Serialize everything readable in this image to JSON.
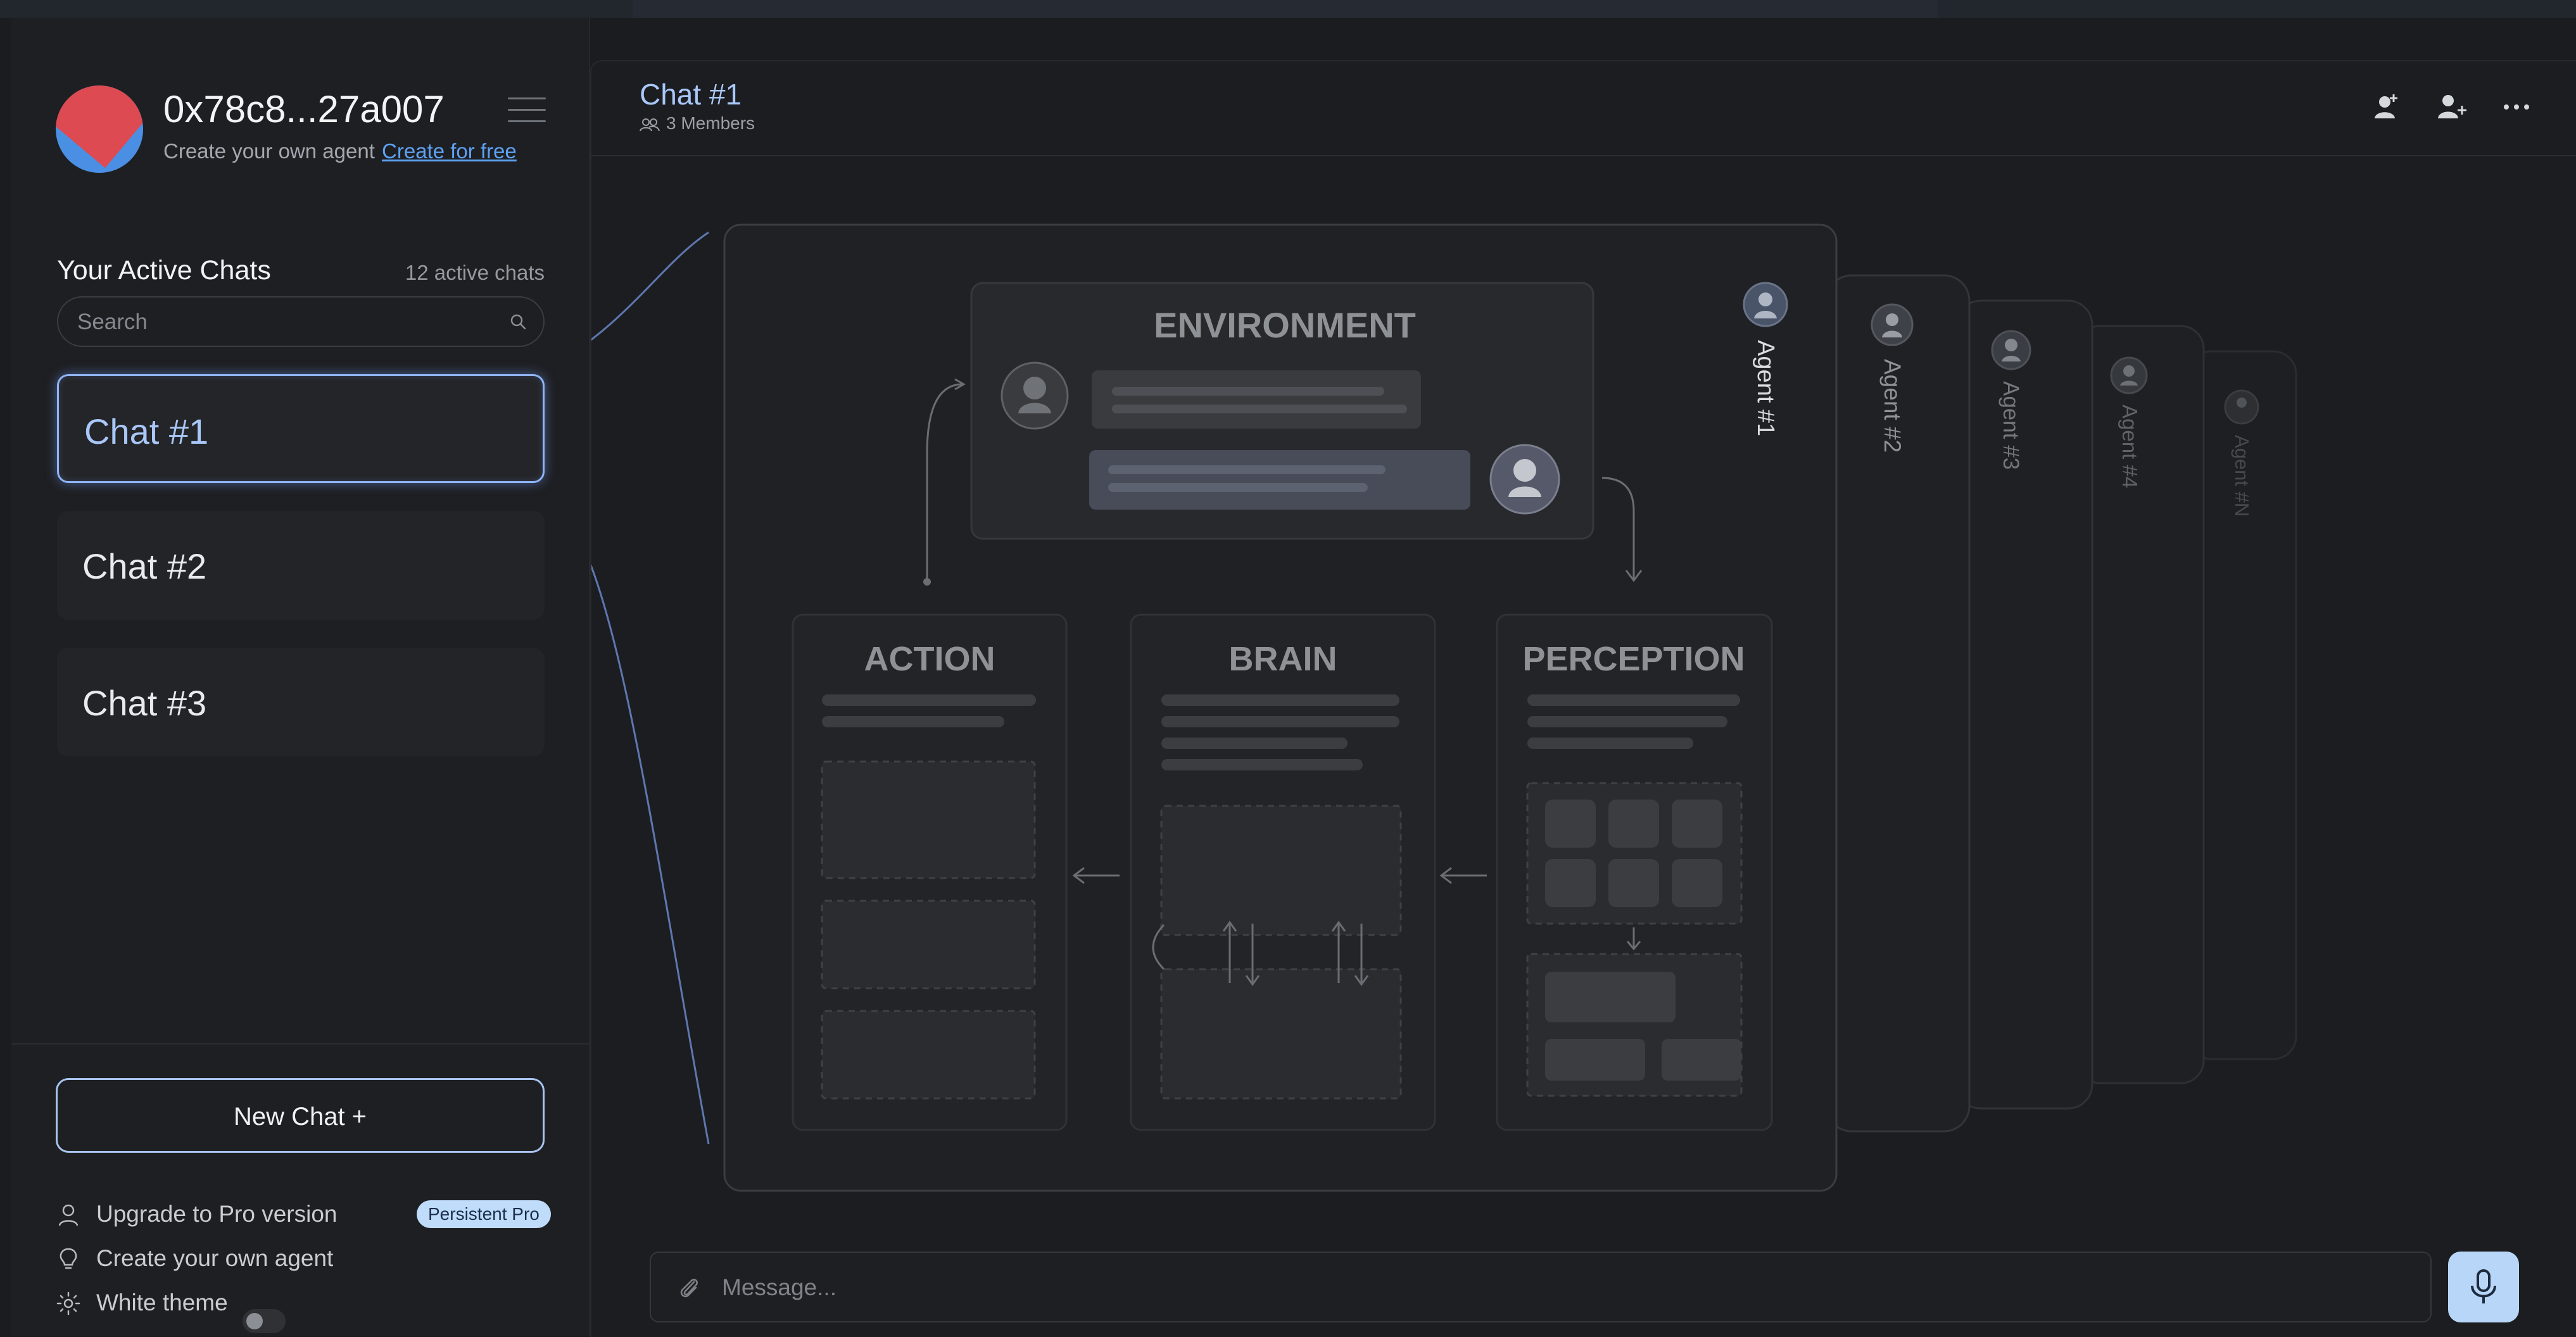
{
  "account": {
    "address": "0x78c8...27a007",
    "subtitle": "Create your own agent",
    "link_label": "Create for free"
  },
  "chats_section": {
    "title": "Your Active Chats",
    "count": "12 active chats",
    "search_placeholder": "Search"
  },
  "chats": [
    {
      "label": "Chat #1",
      "active": true
    },
    {
      "label": "Chat #2",
      "active": false
    },
    {
      "label": "Chat #3",
      "active": false
    }
  ],
  "new_chat": {
    "label": "New Chat +"
  },
  "options": {
    "upgrade": "Upgrade to Pro version",
    "upgrade_badge": "Persistent Pro",
    "create_agent": "Create your own agent",
    "white_theme": "White theme",
    "white_theme_on": false
  },
  "header": {
    "title": "Chat #1",
    "members": "3 Members",
    "icons": [
      "add-agent-icon",
      "add-user-icon",
      "more-options-icon"
    ]
  },
  "diagram": {
    "environment": "ENVIRONMENT",
    "action": "ACTION",
    "brain": "BRAIN",
    "perception": "PERCEPTION",
    "agents": [
      "Agent #1",
      "Agent #2",
      "Agent #3",
      "Agent #4",
      "Agent #N"
    ]
  },
  "composer": {
    "placeholder": "Message..."
  },
  "colors": {
    "accent": "#a9c7f8",
    "link": "#5ea2f5",
    "background": "#1b1c1f",
    "badge_bg": "#bfdcfb"
  }
}
